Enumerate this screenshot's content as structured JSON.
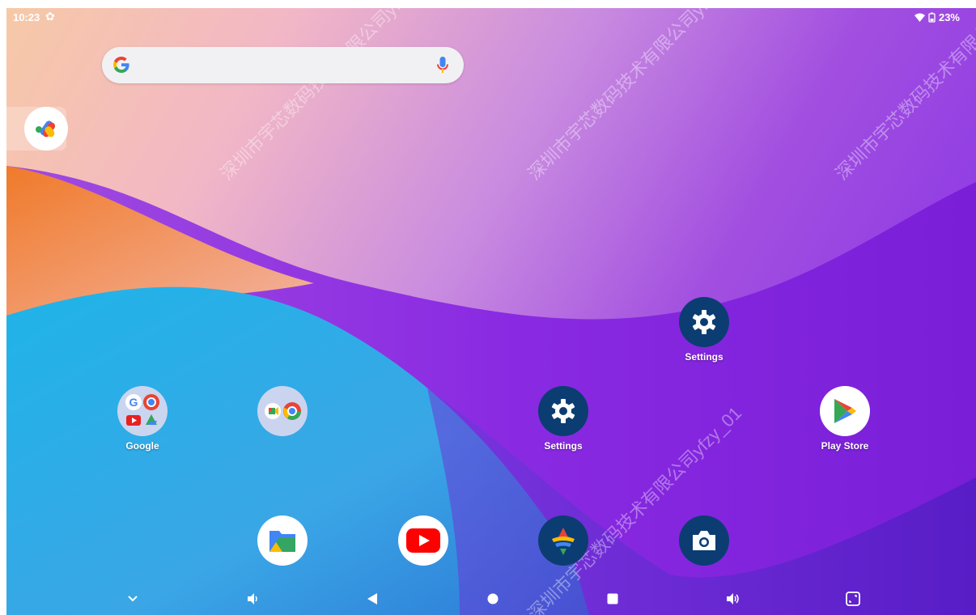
{
  "status_bar": {
    "time": "10:23",
    "battery": "23%"
  },
  "search_bar": {
    "g_icon": "google-g-icon",
    "mic_icon": "mic-icon"
  },
  "apps": {
    "google_folder": {
      "label": "Google"
    },
    "unnamed_folder": {
      "label": ""
    },
    "settings_top": {
      "label": "Settings"
    },
    "settings": {
      "label": "Settings"
    },
    "play_store": {
      "label": "Play Store"
    }
  },
  "dock": [
    "files-icon",
    "youtube-icon",
    "gallery-icon",
    "camera-icon"
  ],
  "navbar": [
    "chevron-down-icon",
    "volume-down-icon",
    "back-icon",
    "home-icon",
    "recents-icon",
    "volume-up-icon",
    "screenshot-icon"
  ],
  "watermarks": {
    "line1": "深圳市宇芯数码技术有限公司yfzy_01",
    "line2": "深圳市宇芯数码技术有限公司yfzy_01",
    "line3": "深圳市宇芯数码技术有限公司yfzy_01",
    "line4": "深圳市宇芯数码技术有限公司yfzy_01"
  },
  "colors": {
    "settings_bg": "#0b3d72",
    "accent_blue": "#4285f4",
    "accent_red": "#ea4335",
    "accent_yellow": "#fbbc05",
    "accent_green": "#34a853"
  }
}
